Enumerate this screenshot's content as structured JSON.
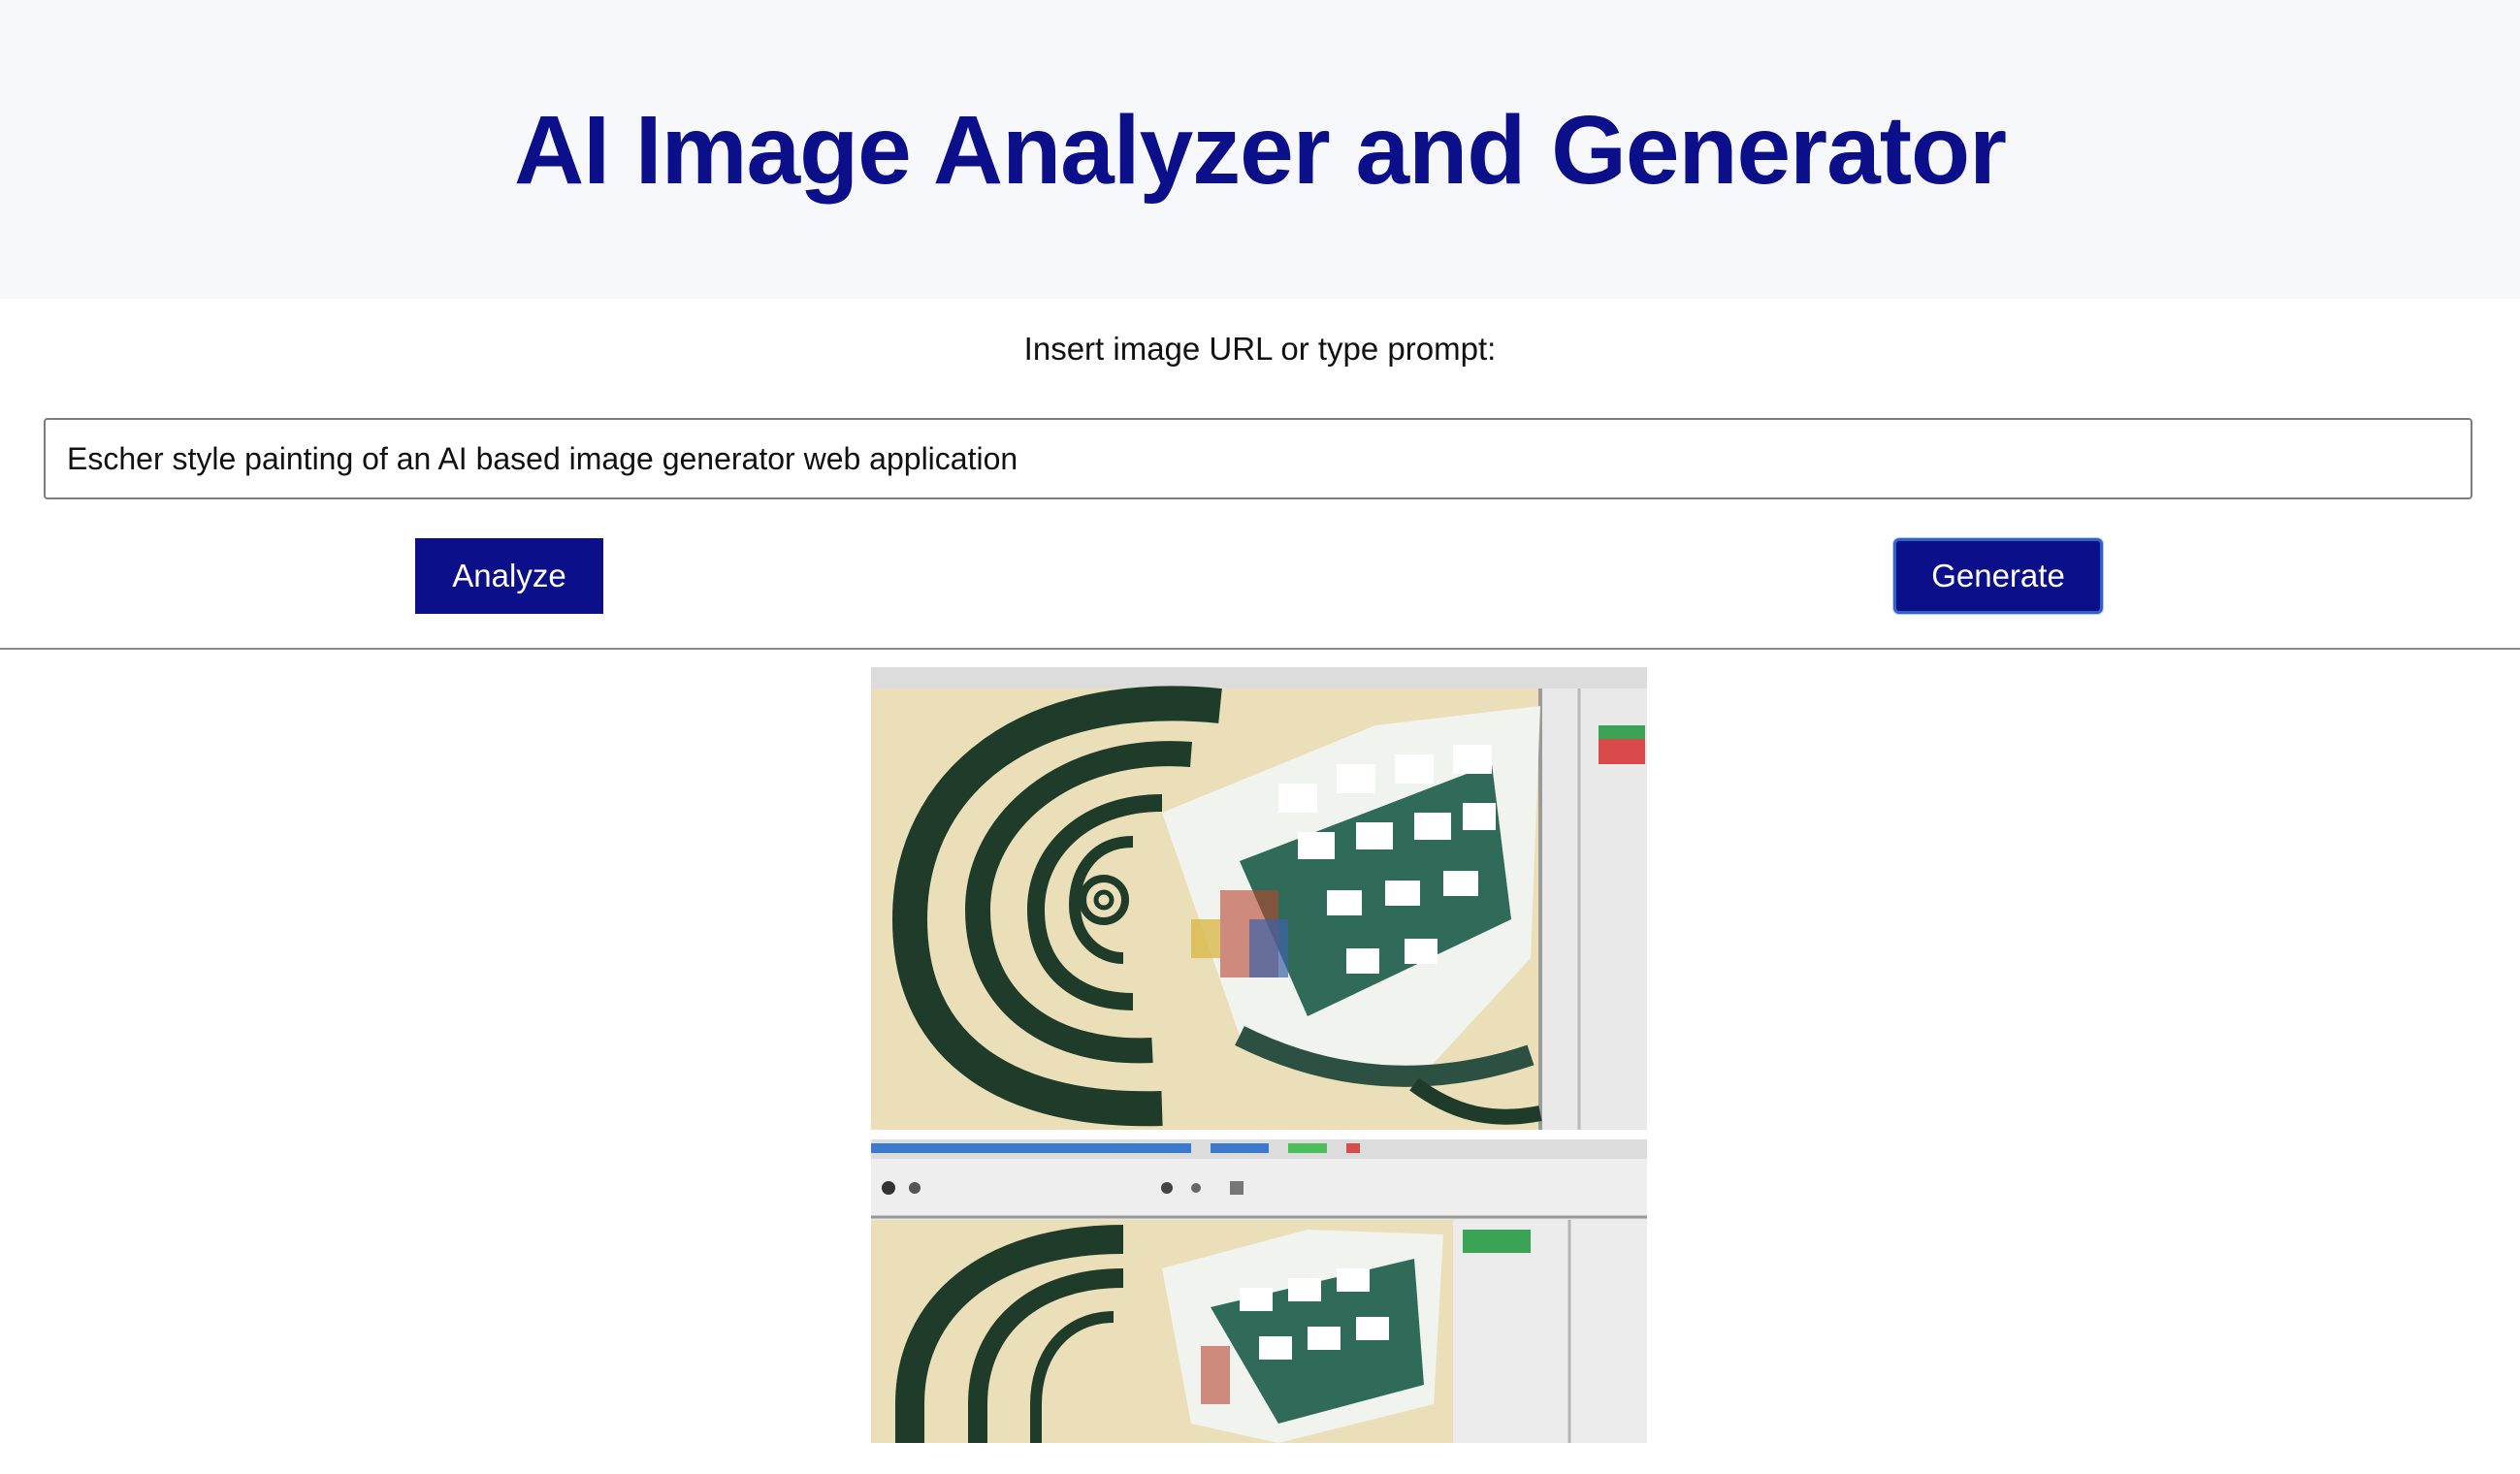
{
  "header": {
    "title": "AI Image Analyzer and Generator"
  },
  "form": {
    "label": "Insert image URL or type prompt:",
    "input_value": "Escher style painting of an AI based image generator web application"
  },
  "buttons": {
    "analyze_label": "Analyze",
    "generate_label": "Generate"
  },
  "result": {
    "image_description_icon": "generated-image"
  },
  "colors": {
    "accent": "#0b108a",
    "header_bg": "#f7f8fc",
    "focus_ring": "#2f63c9"
  }
}
